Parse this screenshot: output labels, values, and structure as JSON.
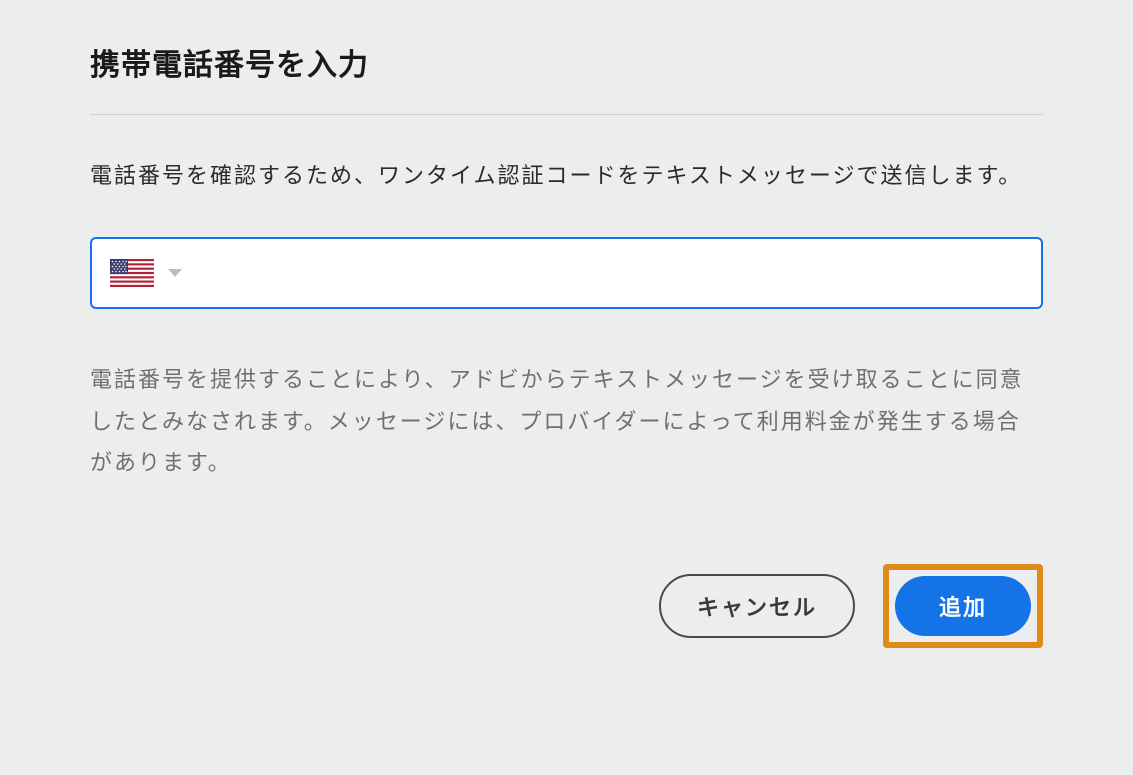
{
  "dialog": {
    "title": "携帯電話番号を入力",
    "description": "電話番号を確認するため、ワンタイム認証コードをテキストメッセージで送信します。",
    "consent_text": "電話番号を提供することにより、アドビからテキストメッセージを受け取ることに同意したとみなされます。メッセージには、プロバイダーによって利用料金が発生する場合があります。"
  },
  "phone_input": {
    "country": "US",
    "value": ""
  },
  "actions": {
    "cancel_label": "キャンセル",
    "add_label": "追加"
  },
  "colors": {
    "accent": "#1473e6",
    "highlight_border": "#e08a1a"
  }
}
